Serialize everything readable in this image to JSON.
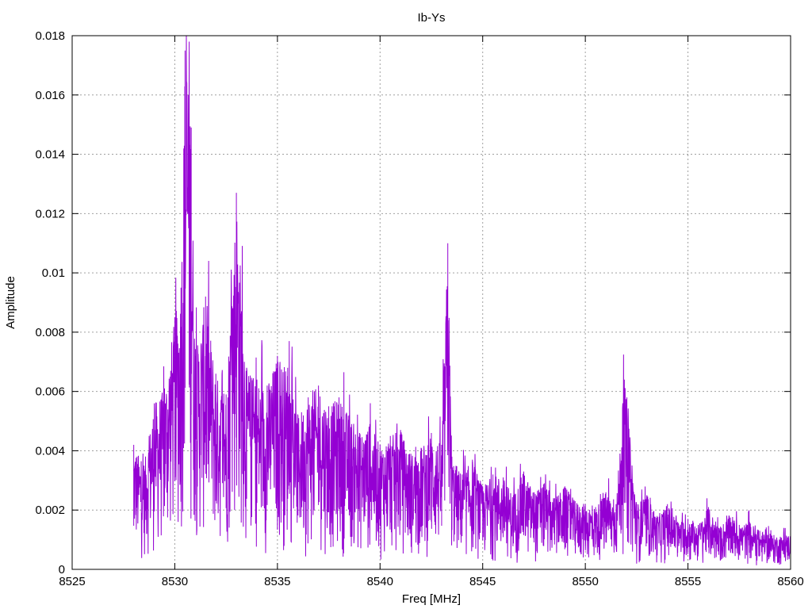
{
  "chart_data": {
    "type": "line",
    "title": "Ib-Ys",
    "xlabel": "Freq [MHz]",
    "ylabel": "Amplitude",
    "xlim": [
      8525,
      8560
    ],
    "ylim": [
      0,
      0.018
    ],
    "x_ticks": [
      "8525",
      "8530",
      "8535",
      "8540",
      "8545",
      "8550",
      "8555",
      "8560"
    ],
    "y_ticks": [
      "0",
      "0.002",
      "0.004",
      "0.006",
      "0.008",
      "0.01",
      "0.012",
      "0.014",
      "0.016",
      "0.018"
    ],
    "grid": true,
    "series_color": "#9400d3",
    "series": [
      {
        "x": [
          8528.0,
          8528.5,
          8529.0,
          8529.5,
          8530.0,
          8530.3,
          8530.5,
          8530.7,
          8530.8,
          8531.0,
          8531.5,
          8532.0,
          8532.5,
          8533.0,
          8533.5,
          8534.0,
          8534.5,
          8535.0,
          8535.5,
          8536.0,
          8536.5,
          8537.0,
          8537.5,
          8538.0,
          8538.5,
          8539.0,
          8539.5,
          8540.0,
          8540.5,
          8541.0,
          8541.5,
          8542.0,
          8542.5,
          8543.0,
          8543.3,
          8543.5,
          8544.0,
          8544.5,
          8545.0,
          8545.5,
          8546.0,
          8546.5,
          8547.0,
          8547.5,
          8548.0,
          8548.5,
          8549.0,
          8549.5,
          8550.0,
          8550.5,
          8551.0,
          8551.5,
          8551.9,
          8552.5,
          8553.0,
          8553.5,
          8554.0,
          8554.5,
          8555.0,
          8555.5,
          8556.0,
          8556.5,
          8557.0,
          8557.5,
          8558.0,
          8558.5,
          8559.0,
          8559.5,
          8560.0
        ],
        "y": [
          0.0042,
          0.0035,
          0.0056,
          0.0061,
          0.0085,
          0.0095,
          0.0175,
          0.0178,
          0.0149,
          0.0072,
          0.0092,
          0.0066,
          0.0059,
          0.0127,
          0.0068,
          0.0064,
          0.0062,
          0.0072,
          0.0068,
          0.0052,
          0.0058,
          0.0062,
          0.0055,
          0.0058,
          0.0052,
          0.0046,
          0.0049,
          0.0042,
          0.0045,
          0.0047,
          0.0039,
          0.0041,
          0.0046,
          0.0042,
          0.011,
          0.0038,
          0.0032,
          0.0037,
          0.0028,
          0.0032,
          0.0031,
          0.0025,
          0.0033,
          0.0026,
          0.0029,
          0.0024,
          0.0028,
          0.0023,
          0.0022,
          0.0021,
          0.0026,
          0.0022,
          0.0064,
          0.0022,
          0.0025,
          0.0018,
          0.0022,
          0.0016,
          0.0017,
          0.0015,
          0.0021,
          0.0014,
          0.0018,
          0.0015,
          0.0016,
          0.0013,
          0.0012,
          0.0011,
          0.0012
        ]
      }
    ]
  }
}
